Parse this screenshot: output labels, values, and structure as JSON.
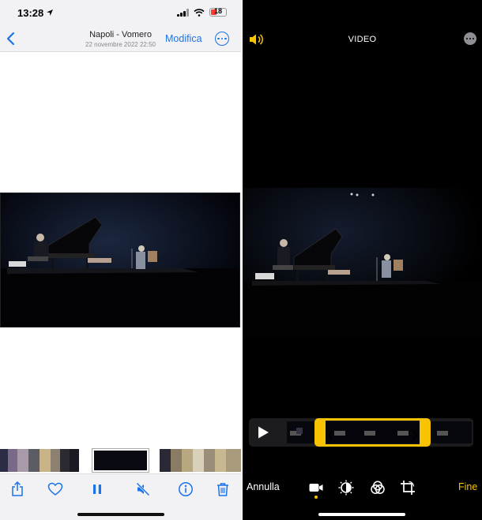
{
  "left_screen": {
    "status_bar": {
      "time": "13:28",
      "battery": "18"
    },
    "nav": {
      "title": "Napoli - Vomero",
      "subtitle": "22 novembre 2022  22:50",
      "edit_label": "Modifica",
      "back_icon": "chevron-left-icon",
      "more_icon": "ellipsis-circle-icon"
    },
    "toolbar": {
      "icons": [
        "share-icon",
        "heart-icon",
        "pause-icon",
        "speaker-muted-icon",
        "info-icon",
        "trash-icon"
      ]
    }
  },
  "right_screen": {
    "header": {
      "title": "VIDEO",
      "sound_icon": "speaker-icon",
      "more_icon": "ellipsis-circle-icon"
    },
    "trim_bar": {
      "play_icon": "play-icon"
    },
    "bottom": {
      "cancel_label": "Annulla",
      "done_label": "Fine",
      "tools": [
        "video-camera-icon",
        "adjust-dial-icon",
        "filters-icon",
        "crop-rotate-icon"
      ]
    }
  },
  "colors": {
    "ios_blue": "#1a73e8",
    "accent_yellow": "#f8c300",
    "panel_gray": "#f2f2f5"
  }
}
